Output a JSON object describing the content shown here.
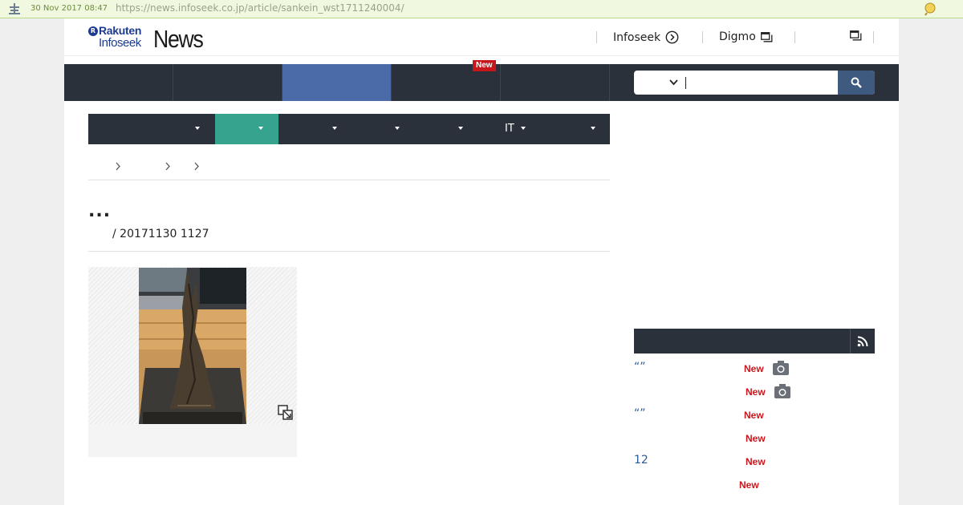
{
  "archive_bar": {
    "date": "30 Nov 2017 08:47",
    "url": "https://news.infoseek.co.jp/article/sankein_wst1711240004/"
  },
  "header": {
    "logo": {
      "rakuten": "Rakuten",
      "infoseek": "Infoseek",
      "news": "News"
    },
    "links": [
      {
        "label": "Infoseek",
        "icon": "circle-arrow-right-icon"
      },
      {
        "label": "Digmo",
        "icon": "external-window-icon"
      },
      {
        "label": "",
        "icon": "external-window-icon"
      }
    ]
  },
  "main_nav": {
    "tabs": [
      {
        "label": ""
      },
      {
        "label": ""
      },
      {
        "label": "",
        "active": true
      },
      {
        "label": "",
        "badge": "New"
      },
      {
        "label": ""
      }
    ]
  },
  "search": {
    "selected": "",
    "value": "",
    "placeholder": ""
  },
  "category_nav": {
    "items": [
      {
        "label": ""
      },
      {
        "label": "",
        "active": true
      },
      {
        "label": ""
      },
      {
        "label": ""
      },
      {
        "label": ""
      },
      {
        "label": "IT"
      },
      {
        "label": ""
      }
    ]
  },
  "article": {
    "title": "...",
    "meta": "/ 20171130 1127"
  },
  "ranking": {
    "title": "",
    "items": [
      {
        "text": "“”",
        "badge": "New",
        "camera": true
      },
      {
        "text": "",
        "badge": "New",
        "camera": true
      },
      {
        "text": "“”",
        "badge": "New",
        "camera": false
      },
      {
        "text": "",
        "badge": "New",
        "camera": false
      },
      {
        "text": "12",
        "badge": "New",
        "camera": false
      },
      {
        "text": "",
        "badge": "New",
        "camera": false
      }
    ]
  },
  "colors": {
    "nav_bg": "#2b313b",
    "nav_active": "#4a6aa8",
    "cat_active": "#36a38e",
    "new_badge": "#c8161d",
    "link": "#2d5a9a"
  }
}
